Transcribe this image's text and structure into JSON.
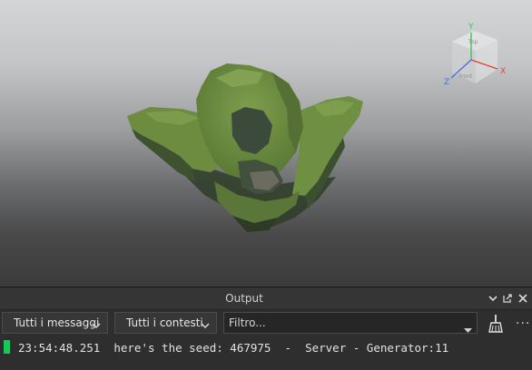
{
  "viewport": {
    "gizmo": {
      "y_label": "Y",
      "x_label": "X",
      "z_label": "Z",
      "top_face_text": "Top",
      "front_face_text": "Front"
    }
  },
  "output": {
    "title": "Output",
    "header_icons": [
      "chevron-down-icon",
      "pop-out-icon",
      "close-icon"
    ],
    "toolbar": {
      "message_filter": "Tutti i messaggi",
      "context_filter": "Tutti i contesti",
      "filter_placeholder": "Filtro...",
      "clear_icon": "broom-icon",
      "more_label": "···"
    },
    "log": [
      {
        "text": "23:54:48.251  here's the seed: 467975  -  Server - Generator:11",
        "status_color": "#18c95a"
      }
    ]
  }
}
